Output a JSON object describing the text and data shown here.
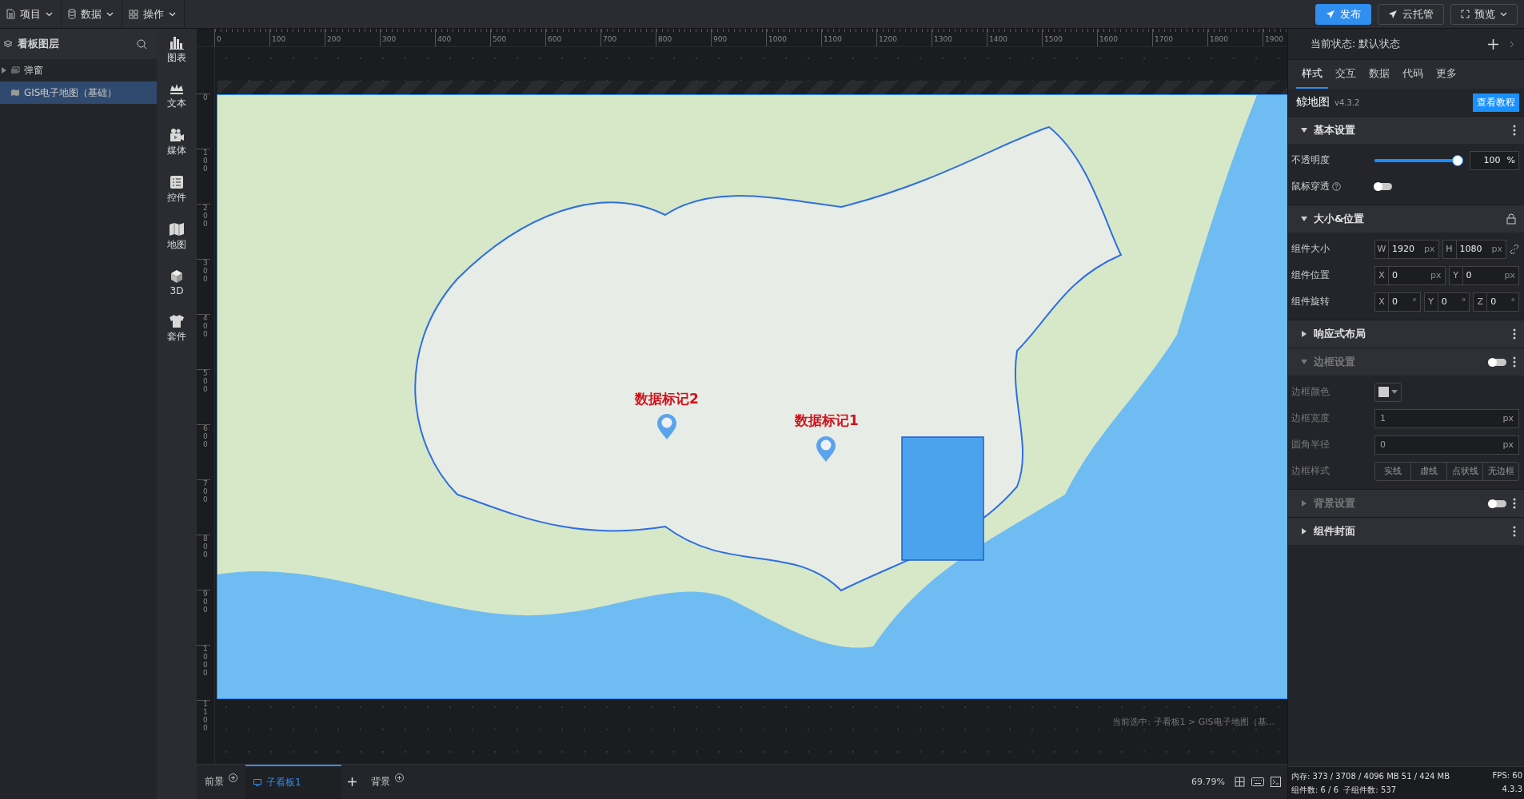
{
  "top_menu": [
    {
      "label": "项目"
    },
    {
      "label": "数据"
    },
    {
      "label": "操作"
    }
  ],
  "top_actions": [
    {
      "label": "发布",
      "kind": "primary"
    },
    {
      "label": "云托管",
      "kind": "outline"
    },
    {
      "label": "预览",
      "kind": "dropdown"
    }
  ],
  "layers": {
    "title": "看板图层",
    "items": [
      {
        "label": "弹窗",
        "kind": "group",
        "expanded": false,
        "selected": false
      },
      {
        "label": "GIS电子地图（基础）",
        "kind": "map",
        "selected": true
      }
    ]
  },
  "toolbar": [
    {
      "label": "图表"
    },
    {
      "label": "文本"
    },
    {
      "label": "媒体"
    },
    {
      "label": "控件"
    },
    {
      "label": "地图"
    },
    {
      "label": "3D"
    },
    {
      "label": "套件"
    }
  ],
  "ruler": {
    "horizontal": [
      "0",
      "100",
      "200",
      "300",
      "400",
      "500",
      "600",
      "700",
      "800",
      "900",
      "1000",
      "1100",
      "1200",
      "1300",
      "1400",
      "1500",
      "1600",
      "1700",
      "1800",
      "1900"
    ],
    "vertical": [
      "0",
      "100",
      "200",
      "300",
      "400",
      "500",
      "600",
      "700",
      "800",
      "900",
      "1000",
      "1100"
    ]
  },
  "map": {
    "markers": [
      {
        "label": "数据标记2"
      },
      {
        "label": "数据标记1"
      }
    ]
  },
  "selection_path": "当前选中: 子看板1 > GIS电子地图（基...",
  "bottom_tabs": [
    {
      "label": "前景",
      "kind": "layer",
      "selected": false
    },
    {
      "label": "子看板1",
      "kind": "board",
      "selected": true
    },
    {
      "label": "背景",
      "kind": "layer",
      "selected": false
    }
  ],
  "zoom": "69.79%",
  "status": {
    "memory": "内存: 373 / 3708 / 4096 MB  51 / 424 MB",
    "fps": "FPS: 60",
    "components": "组件数: 6 / 6",
    "subcomponents": "子组件数: 537",
    "version": "4.3.3"
  },
  "panel": {
    "state_label": "当前状态:",
    "state_value": "默认状态",
    "tabs": [
      {
        "label": "样式",
        "selected": true
      },
      {
        "label": "交互",
        "selected": false
      },
      {
        "label": "数据",
        "selected": false
      },
      {
        "label": "代码",
        "selected": false
      },
      {
        "label": "更多",
        "selected": false
      }
    ],
    "component_name": "鲸地图",
    "component_version": "v4.3.2",
    "tutorial_button": "查看教程",
    "sections": [
      {
        "title": "基本设置",
        "expanded": true,
        "disabled": false,
        "kind": "menu",
        "rows": [
          {
            "kind": "slider",
            "label": "不透明度",
            "level": 1,
            "value": "100",
            "unit": "%"
          },
          {
            "kind": "toggle",
            "label": "鼠标穿透",
            "help": true,
            "on": false
          }
        ]
      },
      {
        "title": "大小&位置",
        "expanded": true,
        "disabled": false,
        "kind": "lock",
        "rows": [
          {
            "kind": "inputs",
            "label": "组件大小",
            "linked": true,
            "fields": [
              {
                "prefix": "W",
                "value": "1920",
                "unit": "px"
              },
              {
                "prefix": "H",
                "value": "1080",
                "unit": "px"
              }
            ]
          },
          {
            "kind": "inputs",
            "label": "组件位置",
            "linked": false,
            "fields": [
              {
                "prefix": "X",
                "value": "0",
                "unit": "px"
              },
              {
                "prefix": "Y",
                "value": "0",
                "unit": "px"
              }
            ]
          },
          {
            "kind": "inputs",
            "label": "组件旋转",
            "linked": false,
            "fields": [
              {
                "prefix": "X",
                "value": "0",
                "unit": "°"
              },
              {
                "prefix": "Y",
                "value": "0",
                "unit": "°"
              },
              {
                "prefix": "Z",
                "value": "0",
                "unit": "°"
              }
            ]
          }
        ]
      },
      {
        "title": "响应式布局",
        "expanded": false,
        "disabled": false,
        "kind": "menu"
      },
      {
        "title": "边框设置",
        "expanded": true,
        "disabled": true,
        "kind": "toggle",
        "on": false,
        "rows": [
          {
            "kind": "color",
            "label": "边框颜色",
            "color": "#cccccc"
          },
          {
            "kind": "text",
            "label": "边框宽度",
            "value": "1",
            "unit": "px"
          },
          {
            "kind": "text",
            "label": "圆角半径",
            "value": "0",
            "unit": "px"
          },
          {
            "kind": "segmented",
            "label": "边框样式",
            "options": [
              {
                "label": "实线",
                "selected": false
              },
              {
                "label": "虚线",
                "selected": false
              },
              {
                "label": "点状线",
                "selected": false
              },
              {
                "label": "无边框",
                "selected": false
              }
            ]
          }
        ]
      },
      {
        "title": "背景设置",
        "expanded": false,
        "disabled": true,
        "kind": "toggle",
        "on": false
      },
      {
        "title": "组件封面",
        "expanded": false,
        "disabled": false,
        "kind": "menu"
      }
    ]
  }
}
